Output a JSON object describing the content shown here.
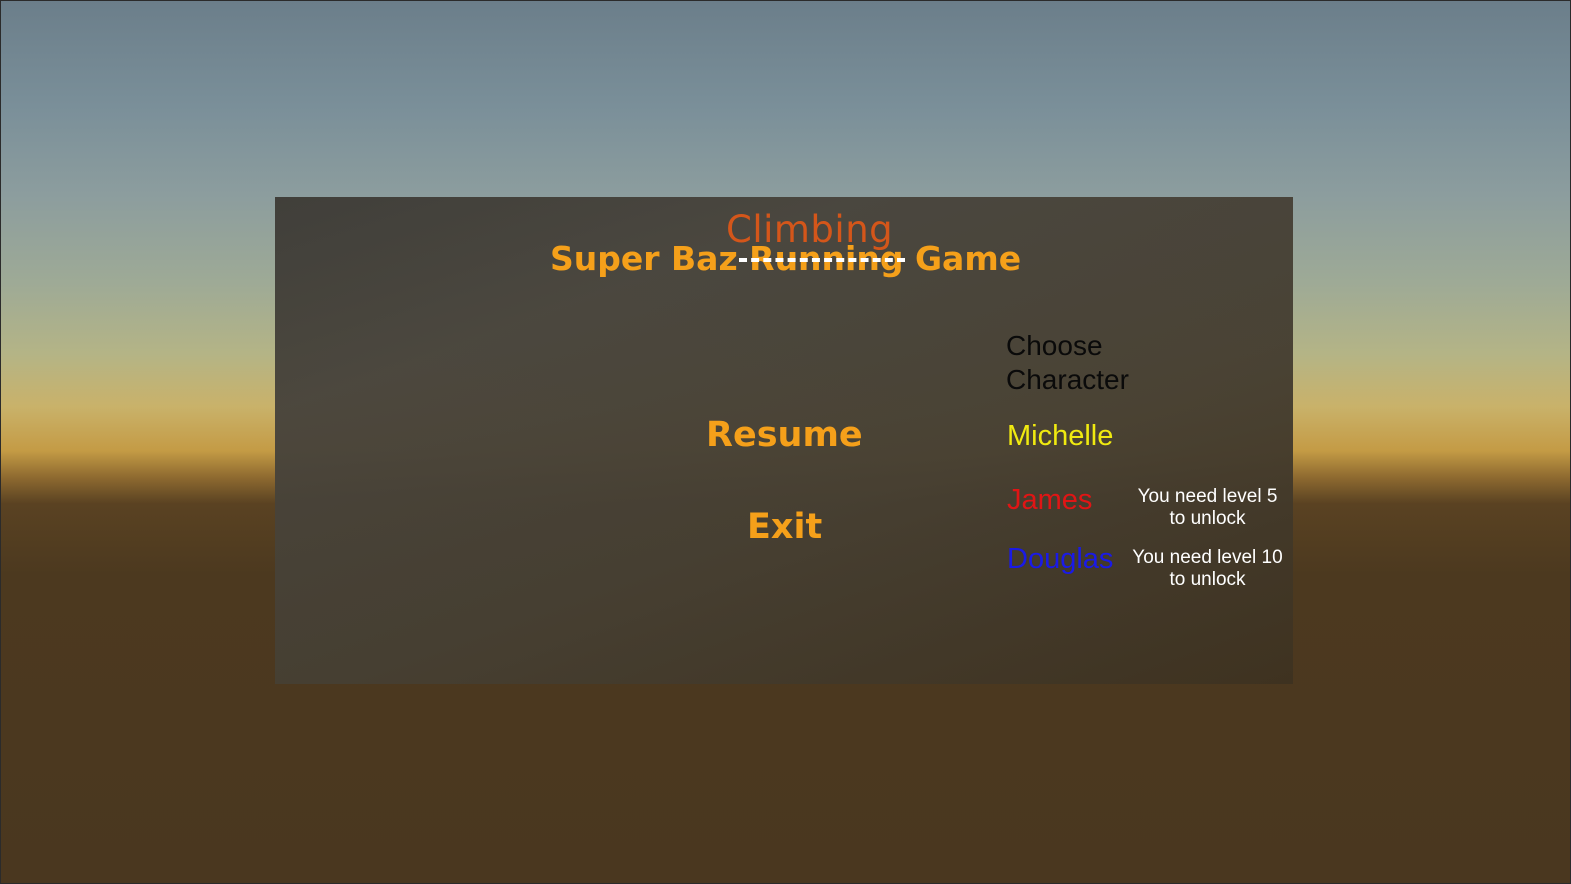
{
  "title": {
    "correction": "Climbing",
    "prefix": "Super Baz ",
    "struck_word": "Running",
    "suffix": " Game"
  },
  "menu": {
    "resume_label": "Resume",
    "exit_label": "Exit"
  },
  "character_select": {
    "heading": "Choose Character",
    "characters": [
      {
        "name": "Michelle",
        "color": "#f0ea10",
        "unlock_text": ""
      },
      {
        "name": "James",
        "color": "#e01515",
        "unlock_line1": "You need level 5",
        "unlock_line2": "to unlock"
      },
      {
        "name": "Douglas",
        "color": "#1a1ae6",
        "unlock_line1": "You need level 10",
        "unlock_line2": "to unlock"
      }
    ]
  },
  "colors": {
    "title_orange": "#f5a01a",
    "correction_orange": "#d4561a",
    "panel": "#45413a"
  }
}
